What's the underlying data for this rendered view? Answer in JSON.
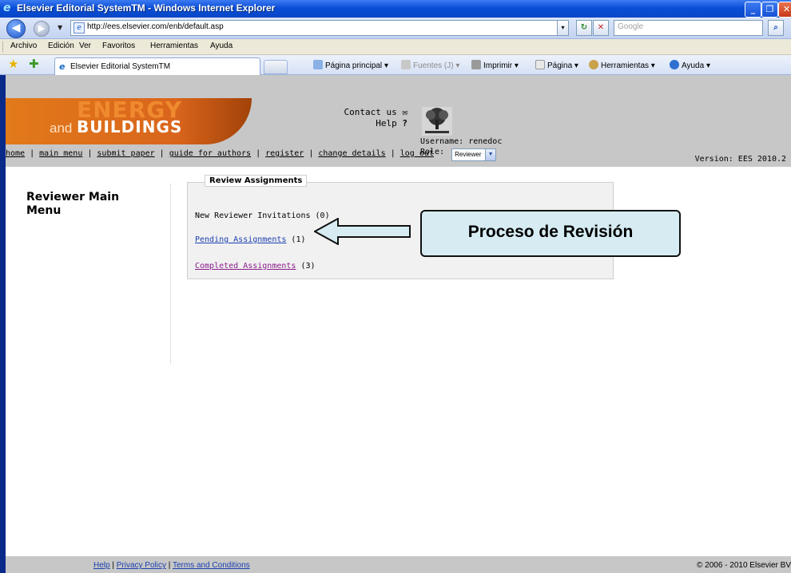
{
  "window": {
    "title": "Elsevier Editorial SystemTM - Windows Internet Explorer"
  },
  "address_bar": {
    "url": "http://ees.elsevier.com/enb/default.asp",
    "search_placeholder": "Google"
  },
  "menu": {
    "items": [
      "Archivo",
      "Edición",
      "Ver",
      "Favoritos",
      "Herramientas",
      "Ayuda"
    ]
  },
  "command_bar": {
    "tab_label": "Elsevier Editorial SystemTM",
    "home_label": "Página principal",
    "feeds_label": "Fuentes (J)",
    "print_label": "Imprimir",
    "page_label": "Página",
    "tools_label": "Herramientas",
    "help_label": "Ayuda"
  },
  "site": {
    "logo_line1": "ENERGY",
    "logo_and": "and",
    "logo_line2": "BUILDINGS",
    "contact_label": "Contact us",
    "help_label": "Help",
    "username_text": "Username: renedoc",
    "role_label": "Role:",
    "role_value": "Reviewer",
    "version": "Version: EES 2010.2",
    "nav": [
      "home",
      "main menu",
      "submit paper",
      "guide for authors",
      "register",
      "change details",
      "log out"
    ]
  },
  "main": {
    "left_menu_title": "Reviewer Main Menu",
    "panel_title": "Review Assignments",
    "items": [
      {
        "label": "New Reviewer Invitations",
        "count": "(0)"
      },
      {
        "label": "Pending Assignments",
        "count": "(1)"
      },
      {
        "label": "Completed Assignments",
        "count": "(3)"
      }
    ],
    "callout": "Proceso de Revisión"
  },
  "footer": {
    "help": "Help",
    "privacy": "Privacy Policy",
    "terms": "Terms and Conditions",
    "copyright": "© 2006 - 2010 Elsevier BV"
  }
}
